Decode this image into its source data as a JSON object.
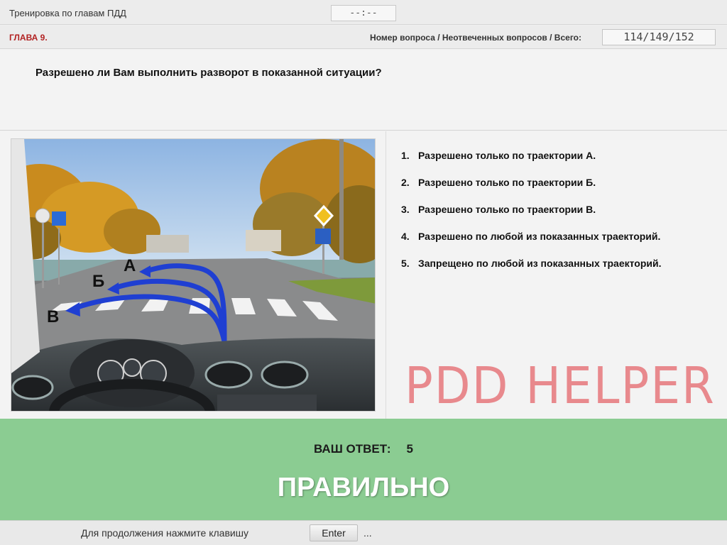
{
  "header": {
    "title": "Тренировка по главам ПДД",
    "timer": "--:--"
  },
  "infobar": {
    "chapter": "ГЛАВА 9.",
    "counter_label": "Номер вопроса / Неотвеченных вопросов / Всего:",
    "counter_value": "114/149/152"
  },
  "question": {
    "text": "Разрешено ли Вам выполнить разворот в показанной ситуации?"
  },
  "picture": {
    "labels": [
      "А",
      "Б",
      "В"
    ]
  },
  "answers": [
    {
      "num": "1.",
      "text": "Разрешено только по траектории А."
    },
    {
      "num": "2.",
      "text": "Разрешено только по траектории Б."
    },
    {
      "num": "3.",
      "text": "Разрешено только по траектории В."
    },
    {
      "num": "4.",
      "text": "Разрешено по любой из показанных траекторий."
    },
    {
      "num": "5.",
      "text": "Запрещено по любой из показанных траекторий."
    }
  ],
  "watermark": "PDD HELPER",
  "result": {
    "label": "ВАШ ОТВЕТ:",
    "value": "5",
    "verdict": "ПРАВИЛЬНО",
    "color": "#8bcc92"
  },
  "footer": {
    "hint": "Для продолжения нажмите клавишу",
    "key": "Enter",
    "dots": "..."
  }
}
